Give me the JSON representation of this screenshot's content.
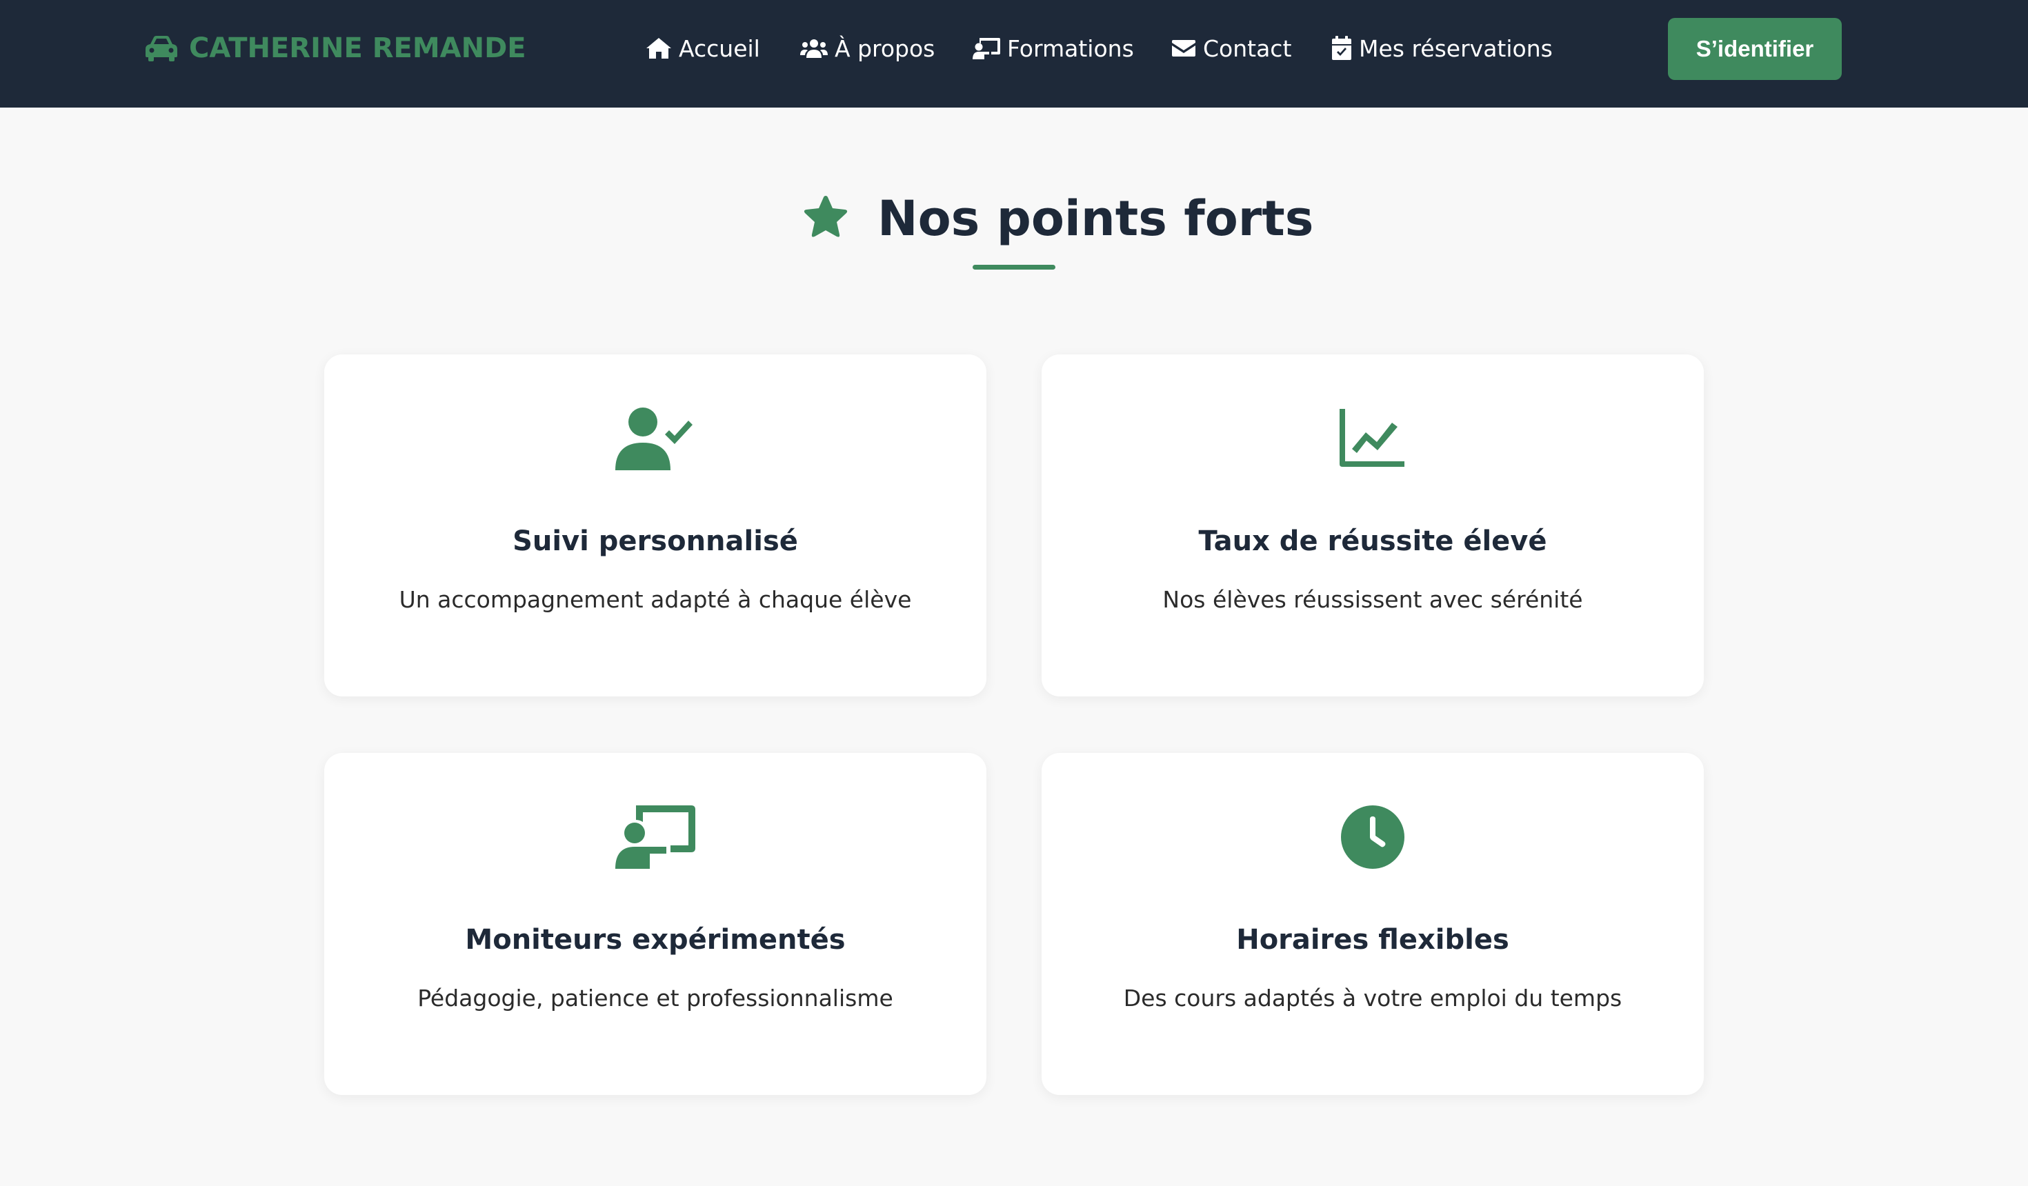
{
  "brand": {
    "name": "CATHERINE REMANDE",
    "icon": "car-icon",
    "color": "#3f8a5e"
  },
  "nav": {
    "items": [
      {
        "label": "Accueil",
        "icon": "home-icon"
      },
      {
        "label": "À propos",
        "icon": "users-icon"
      },
      {
        "label": "Formations",
        "icon": "chalkboard-teacher-icon"
      },
      {
        "label": "Contact",
        "icon": "envelope-icon"
      },
      {
        "label": "Mes réservations",
        "icon": "calendar-check-icon"
      }
    ],
    "login_label": "S’identifier"
  },
  "section": {
    "title": "Nos points forts",
    "icon": "star-icon"
  },
  "features": [
    {
      "title": "Suivi personnalisé",
      "description": "Un accompagnement adapté à chaque élève",
      "icon": "user-check-icon"
    },
    {
      "title": "Taux de réussite élevé",
      "description": "Nos élèves réussissent avec sérénité",
      "icon": "chart-line-icon"
    },
    {
      "title": "Moniteurs expérimentés",
      "description": "Pédagogie, patience et professionnalisme",
      "icon": "chalkboard-teacher-icon"
    },
    {
      "title": "Horaires flexibles",
      "description": "Des cours adaptés à votre emploi du temps",
      "icon": "clock-icon"
    }
  ],
  "colors": {
    "navbar": "#1e2939",
    "accent": "#3f8a5e",
    "background": "#f8f8f8"
  }
}
